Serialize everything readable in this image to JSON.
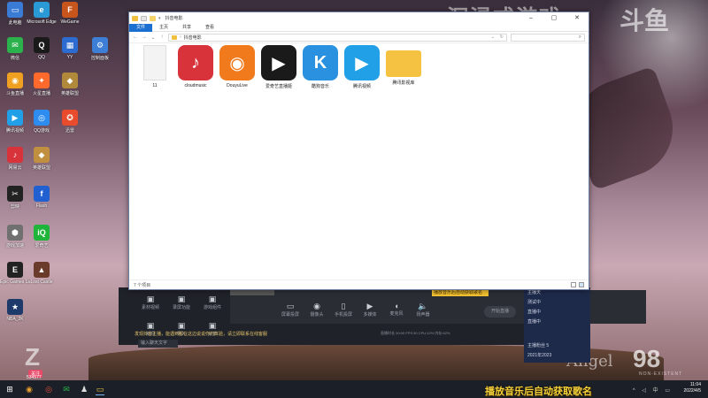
{
  "watermark": {
    "title": "沉浸式游戏",
    "logo": "斗鱼",
    "angel": "Angel",
    "angel_num": "98",
    "angel_sub": "NON-EXISTENT",
    "scroll_text": "播放音乐后自动获取歌名",
    "viewer_badge": "Z",
    "follow_label": "关注",
    "follow_count": "534577"
  },
  "desktop_icons": [
    {
      "label": "此电脑",
      "color": "#3a7bd5",
      "glyph": "▭"
    },
    {
      "label": "Microsoft Edge",
      "color": "#2a9ad6",
      "glyph": "e"
    },
    {
      "label": "WeGame",
      "color": "#c8561c",
      "glyph": "F"
    },
    {
      "label": "微信",
      "color": "#2bb24c",
      "glyph": "✉"
    },
    {
      "label": "QQ",
      "color": "#1a1a1a",
      "glyph": "Q"
    },
    {
      "label": "YY",
      "color": "#2c6bd0",
      "glyph": "▦"
    },
    {
      "label": "控制面板",
      "color": "#3d7fd6",
      "glyph": "⚙"
    },
    {
      "label": "斗鱼直播",
      "color": "#f0a020",
      "glyph": "◉"
    },
    {
      "label": "火星直播",
      "color": "#ff6a2c",
      "glyph": "✦"
    },
    {
      "label": "英雄联盟",
      "color": "#b08a3a",
      "glyph": "◆"
    },
    {
      "label": "腾讯视频",
      "color": "#21a0e8",
      "glyph": "▶"
    },
    {
      "label": "QQ游戏",
      "color": "#2c8cf0",
      "glyph": "◎"
    },
    {
      "label": "迅雷",
      "color": "#e84c2c",
      "glyph": "✪"
    },
    {
      "label": "网易云",
      "color": "#d8333a",
      "glyph": "♪"
    },
    {
      "label": "英雄联盟",
      "color": "#c09040",
      "glyph": "◆"
    },
    {
      "label": "剪映",
      "color": "#222",
      "glyph": "✂"
    },
    {
      "label": "Flash",
      "color": "#2060d0",
      "glyph": "f"
    },
    {
      "label": "游戏加速",
      "color": "#707070",
      "glyph": "⬢"
    },
    {
      "label": "爱奇艺",
      "color": "#1eb53a",
      "glyph": "iQ"
    },
    {
      "label": "Epic Games Launcher",
      "color": "#222",
      "glyph": "E"
    },
    {
      "label": "Lost Castle",
      "color": "#6a3a2a",
      "glyph": "▲"
    },
    {
      "label": "NBA_2K",
      "color": "#1e3a6a",
      "glyph": "★"
    }
  ],
  "explorer": {
    "title": "抖音电影",
    "tabs": [
      "文件",
      "主页",
      "共享",
      "查看"
    ],
    "active_tab": 0,
    "address": "抖音电影",
    "search_placeholder": "",
    "status": "7 个项目",
    "files": [
      {
        "name": "11",
        "kind": "doc",
        "color": "#f2f2f2"
      },
      {
        "name": "cloudmusic",
        "kind": "app",
        "color": "#d8333a",
        "glyph": "♪"
      },
      {
        "name": "DouyuLive",
        "kind": "app",
        "color": "#f07a1c",
        "glyph": "◉"
      },
      {
        "name": "爱奇艺直播姬",
        "kind": "app",
        "color": "#1a1a1a",
        "glyph": "▶"
      },
      {
        "name": "酷狗音乐",
        "kind": "app",
        "color": "#2a90e0",
        "glyph": "K"
      },
      {
        "name": "腾讯视频",
        "kind": "app",
        "color": "#21a0e8",
        "glyph": "▶"
      },
      {
        "name": "腾讯影视库",
        "kind": "folder",
        "color": "#f5c242",
        "glyph": ""
      }
    ]
  },
  "stream_app": {
    "left_buttons": [
      "素材视频",
      "录屏功能",
      "游戏组件"
    ],
    "left_buttons2": [
      "新闻",
      "导入",
      "分享"
    ],
    "toolbar": [
      "屏幕投屏",
      "摄像头",
      "手机投屏",
      "多媒体",
      "麦克风",
      "扬声器"
    ],
    "start_label": "开始直播",
    "banner": "发现抖音主播，能遇到都在这边说说你的体验，请立即联系在线客服",
    "stats": "直播时长 00:00  FPS:30  CPU:12%  内存:62%",
    "input_placeholder": "输入聊天文字"
  },
  "side_panel": {
    "items": [
      "主播天",
      "测试中",
      "直播中",
      "直播中",
      "",
      "",
      "",
      "",
      "主播粉丝 5",
      "2021年2023"
    ]
  },
  "song_toast": "播放音乐后自动获取歌名",
  "taskbar": {
    "apps": [
      "windows-icon",
      "obs-icon",
      "chrome-icon",
      "wechat-icon",
      "qq-icon",
      "explorer-icon"
    ],
    "time": "11:04",
    "date": "2022/4/5",
    "tray": "^ ◁ 中 ▭"
  }
}
